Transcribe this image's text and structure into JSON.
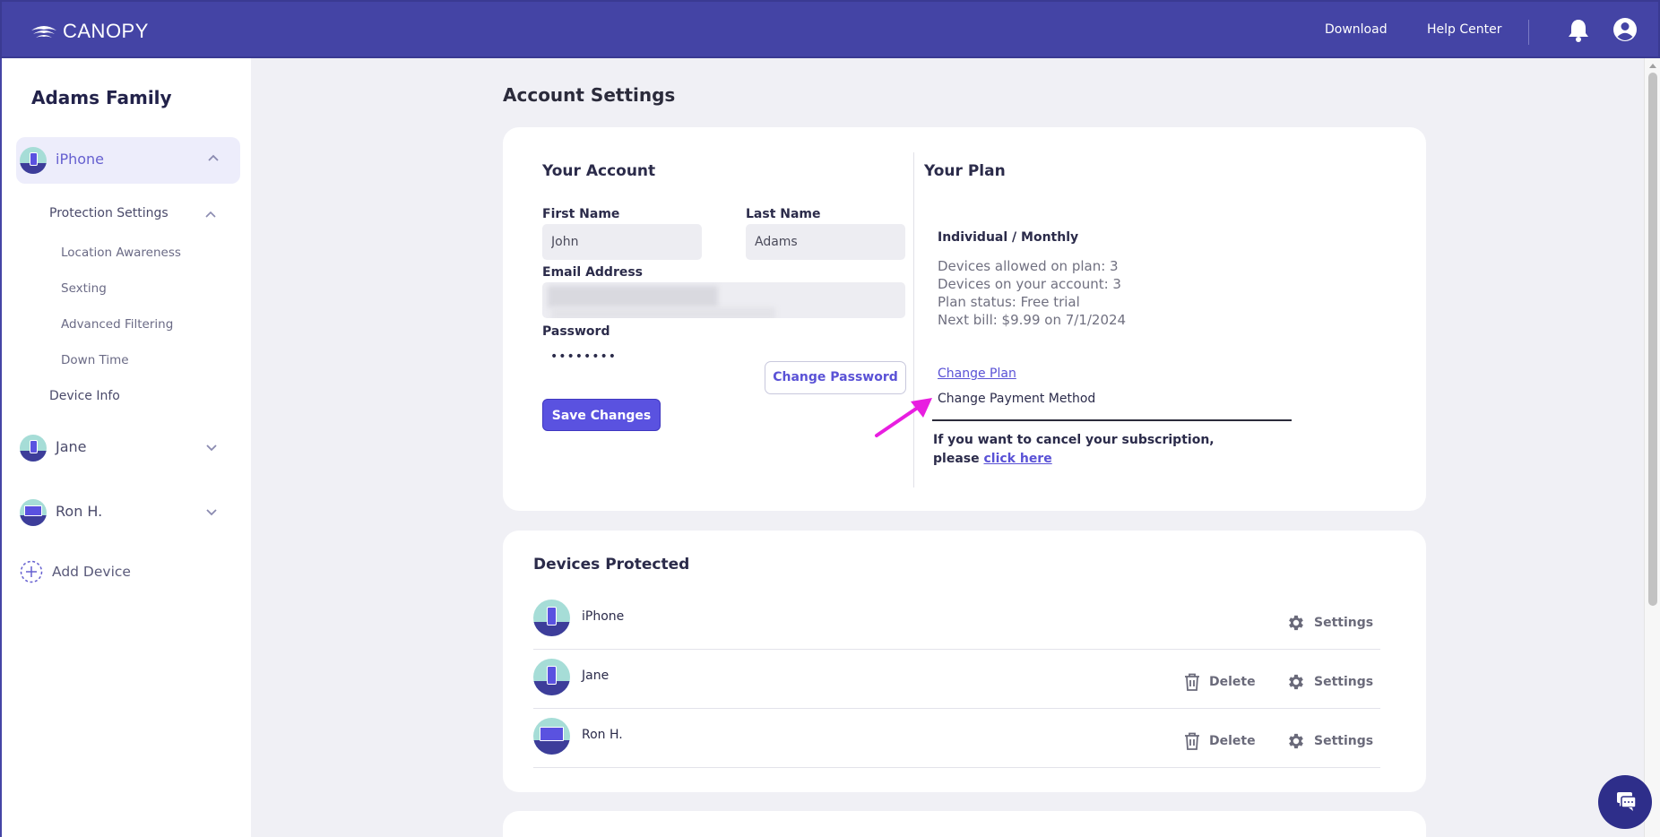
{
  "header": {
    "brand": "CANOPY",
    "download": "Download",
    "help_center": "Help Center"
  },
  "sidebar": {
    "family_name": "Adams Family",
    "devices": [
      {
        "name": "iPhone",
        "type": "phone",
        "expanded": true
      },
      {
        "name": "Jane",
        "type": "phone",
        "expanded": false
      },
      {
        "name": "Ron H.",
        "type": "monitor",
        "expanded": false
      }
    ],
    "protection_settings": "Protection Settings",
    "sub_items": [
      "Location Awareness",
      "Sexting",
      "Advanced Filtering",
      "Down Time"
    ],
    "device_info": "Device Info",
    "add_device": "Add Device"
  },
  "main": {
    "page_title": "Account Settings",
    "account": {
      "title": "Your Account",
      "first_name_label": "First Name",
      "first_name": "John",
      "last_name_label": "Last Name",
      "last_name": "Adams",
      "email_label": "Email Address",
      "password_label": "Password",
      "password_masked": "••••••••",
      "change_password": "Change Password",
      "save_changes": "Save Changes"
    },
    "plan": {
      "title": "Your Plan",
      "name": "Individual / Monthly",
      "details": [
        "Devices allowed on plan: 3",
        "Devices on your account: 3",
        "Plan status: Free trial",
        "Next bill: $9.99 on 7/1/2024"
      ],
      "change_plan": "Change Plan",
      "change_payment": "Change Payment Method",
      "cancel_line1": "If you want to cancel your subscription,",
      "cancel_line2": "please",
      "cancel_link": "click here"
    },
    "devices_protected": {
      "title": "Devices Protected",
      "rows": [
        {
          "name": "iPhone",
          "type": "phone",
          "delete": "",
          "settings": "Settings"
        },
        {
          "name": "Jane",
          "type": "phone",
          "delete": "Delete",
          "settings": "Settings"
        },
        {
          "name": "Ron H.",
          "type": "monitor",
          "delete": "Delete",
          "settings": "Settings"
        }
      ]
    }
  },
  "colors": {
    "header_bg": "#4444a5",
    "accent": "#5a52e0",
    "page_bg": "#f0f0f5",
    "annotation_arrow": "#e81ee0"
  }
}
